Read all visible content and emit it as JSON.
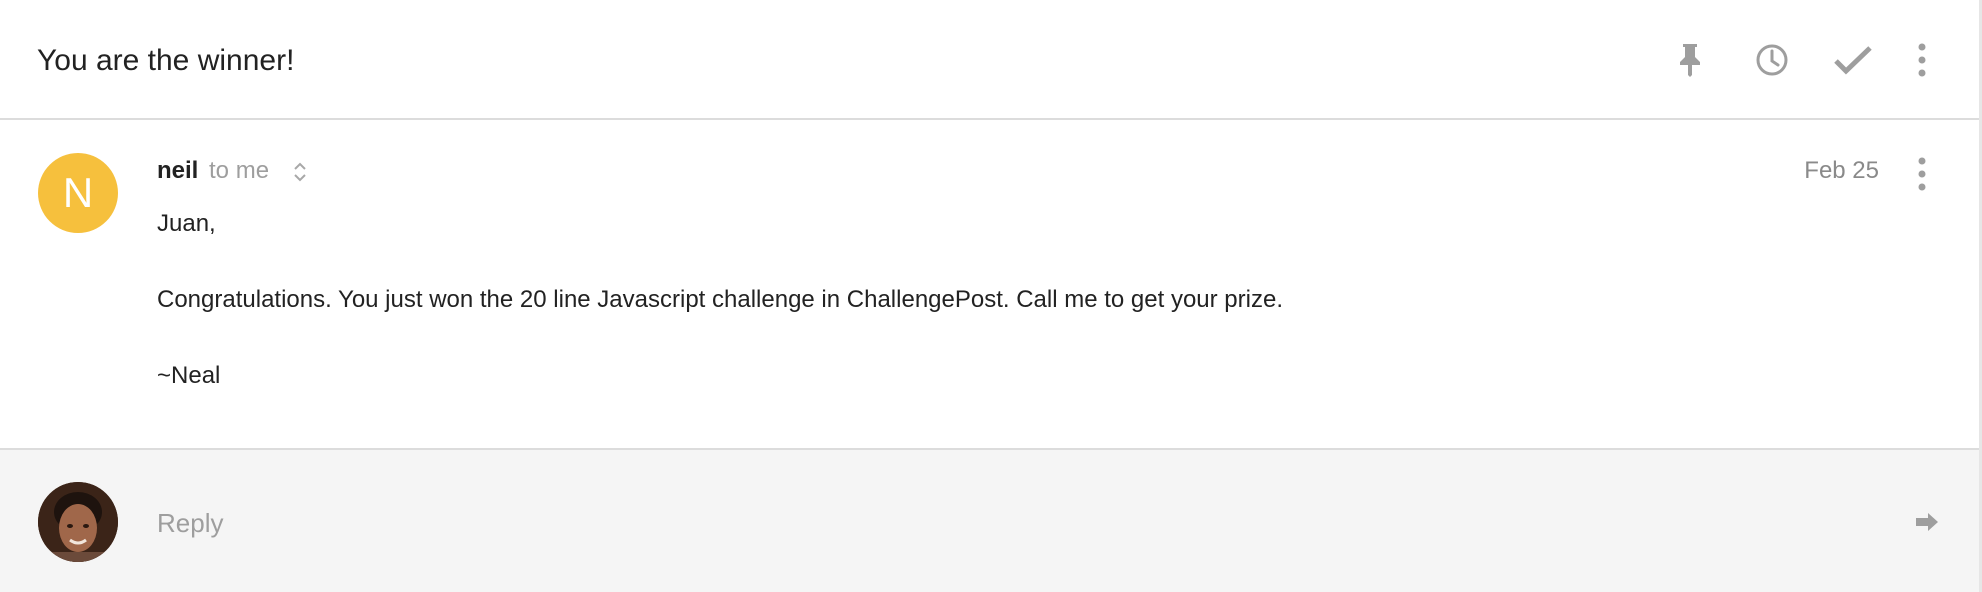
{
  "thread": {
    "subject": "You are the winner!",
    "actions": [
      {
        "name": "pin-icon"
      },
      {
        "name": "snooze-clock-icon"
      },
      {
        "name": "done-check-icon"
      },
      {
        "name": "more-vert-icon"
      }
    ]
  },
  "message": {
    "avatar_letter": "N",
    "avatar_color": "#f6c03d",
    "sender": "neil",
    "recipients": "to me",
    "date": "Feb 25",
    "body": {
      "greeting": "Juan,",
      "paragraph": "Congratulations. You just won the 20 line Javascript challenge in ChallengePost. Call me to get your prize.",
      "signature": "~Neal"
    }
  },
  "reply": {
    "placeholder": "Reply"
  },
  "colors": {
    "icon_gray": "#9e9e9e",
    "reply_bg": "#f5f5f5",
    "divider": "#dcdcdc"
  }
}
